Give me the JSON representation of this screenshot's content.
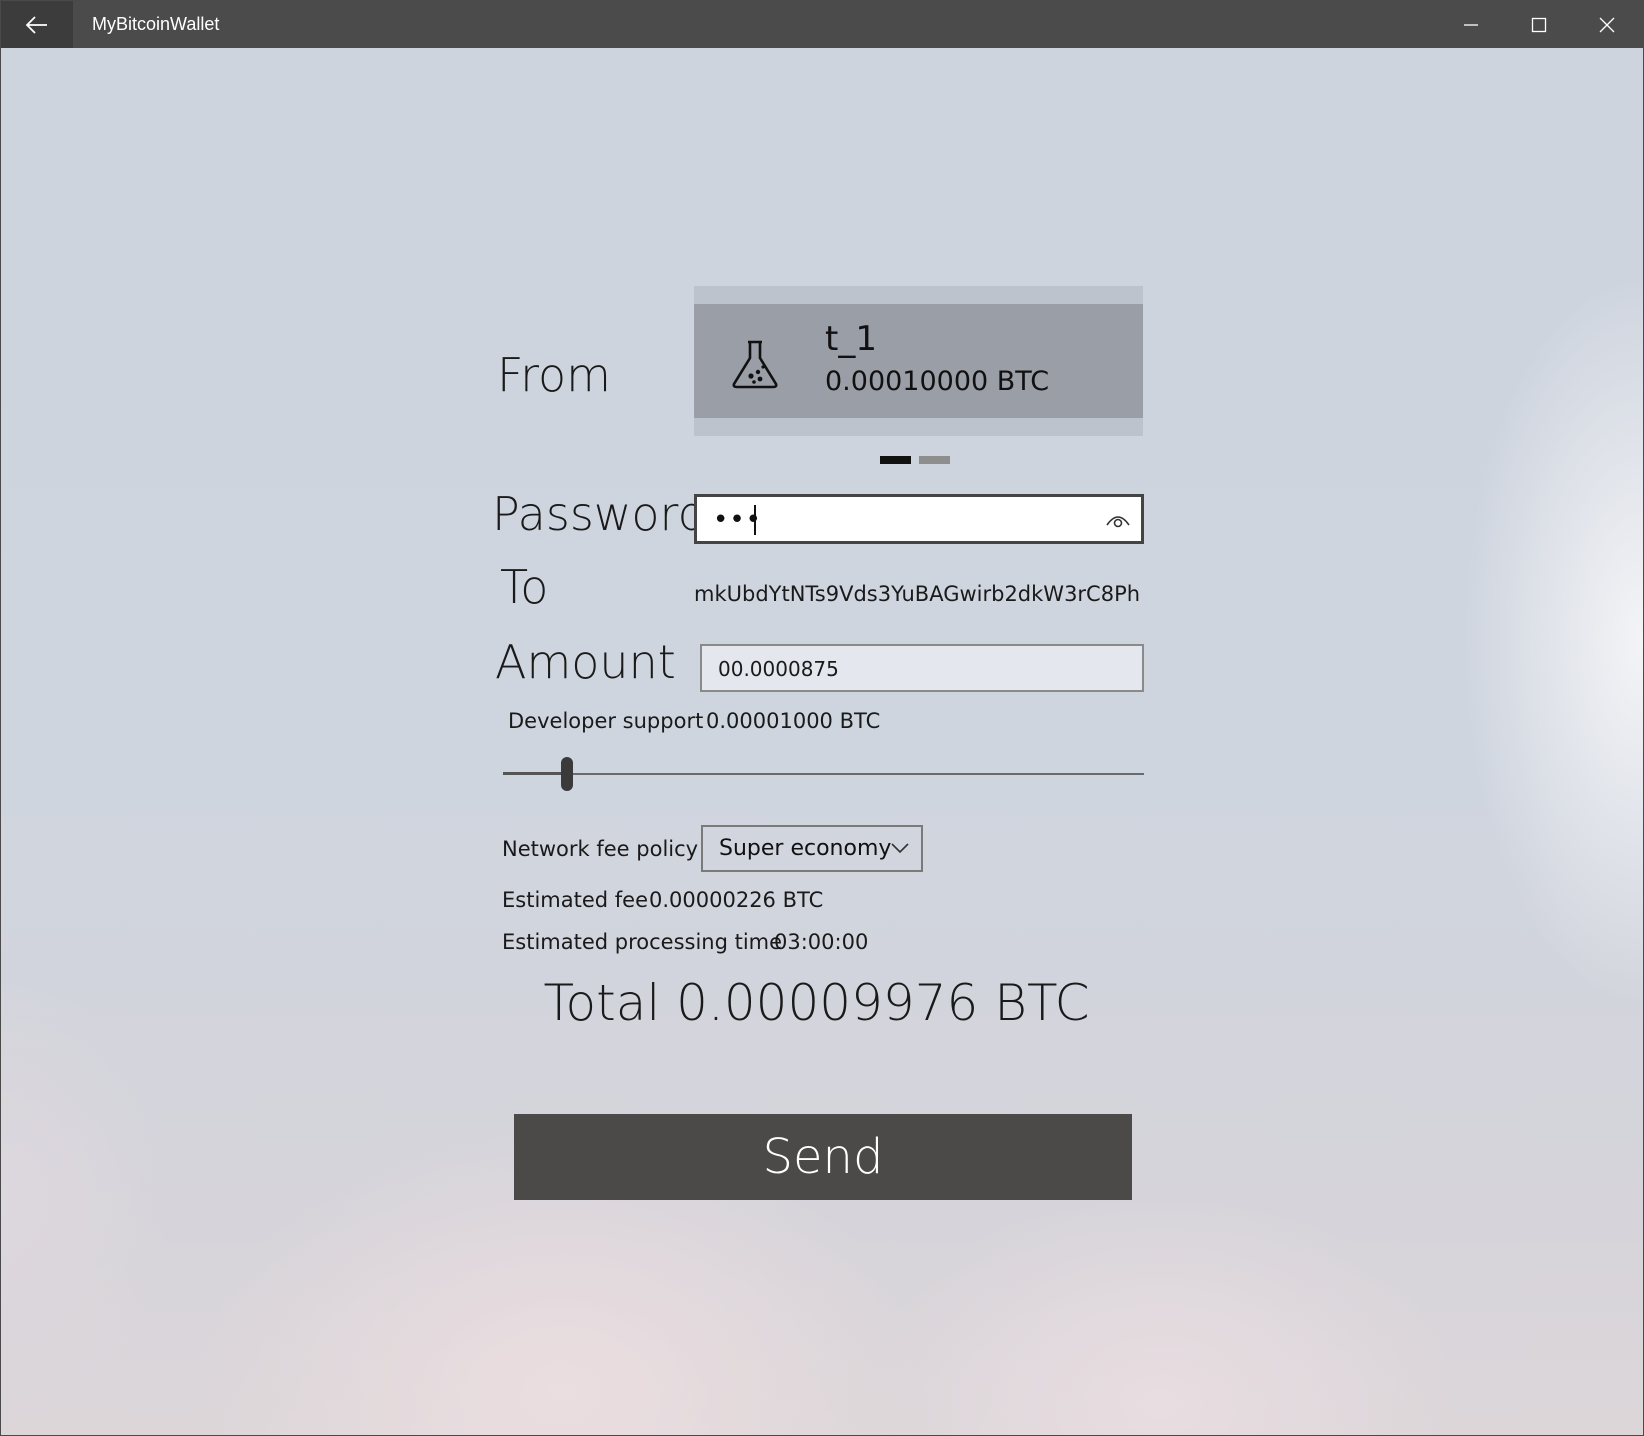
{
  "titlebar": {
    "app_title": "MyBitcoinWallet"
  },
  "form": {
    "from_label": "From",
    "account": {
      "name": "t_1",
      "balance": "0.00010000 BTC",
      "icon": "flask-icon"
    },
    "pager": {
      "count": 2,
      "selected": 1
    },
    "password_label": "Password",
    "password_value": "•••",
    "to_label": "To",
    "to_address": "mkUbdYtNTs9Vds3YuBAGwirb2dkW3rC8Ph",
    "amount_label": "Amount",
    "amount_value": "00.0000875",
    "developer_support_label": "Developer support",
    "developer_support_value": "0.00001000 BTC",
    "developer_support_slider": 0.1,
    "network_fee_label": "Network fee policy",
    "network_fee_selected": "Super economy",
    "estimated_fee_label": "Estimated fee",
    "estimated_fee_value": "0.00000226 BTC",
    "processing_time_label": "Estimated processing time",
    "processing_time_value": "03:00:00",
    "total_label": "Total",
    "total_value": "0.00009976 BTC",
    "send_label": "Send"
  },
  "colors": {
    "titlebar": "#4b4b4b",
    "button": "#4b4a48",
    "card": "#9a9ea6"
  }
}
